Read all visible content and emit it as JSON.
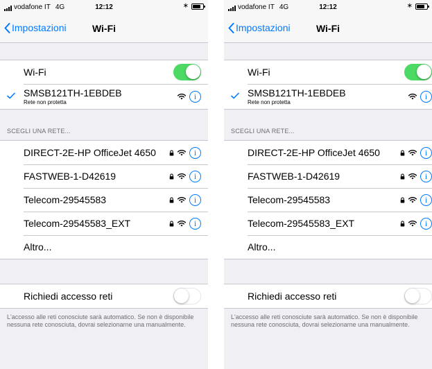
{
  "status_bar": {
    "carrier": "vodafone IT",
    "network": "4G",
    "time": "12:12"
  },
  "nav": {
    "back_label": "Impostazioni",
    "title": "Wi-Fi"
  },
  "wifi_toggle": {
    "label": "Wi-Fi",
    "on": true
  },
  "connected": {
    "name": "SMSB121TH-1EBDEB",
    "subtitle": "Rete non protetta"
  },
  "section_header": "SCEGLI UNA RETE...",
  "networks": [
    {
      "name": "DIRECT-2E-HP OfficeJet 4650",
      "locked": true
    },
    {
      "name": "FASTWEB-1-D42619",
      "locked": true
    },
    {
      "name": "Telecom-29545583",
      "locked": true
    },
    {
      "name": "Telecom-29545583_EXT",
      "locked": true
    }
  ],
  "other_label": "Altro...",
  "ask_to_join": {
    "label": "Richiedi accesso reti",
    "on": false
  },
  "footer_text": "L'accesso alle reti conosciute sarà automatico. Se non è disponibile nessuna rete conosciuta, dovrai selezionarne una manualmente.",
  "colors": {
    "accent": "#007aff",
    "toggle_on": "#4cd964",
    "background": "#efeff4"
  }
}
